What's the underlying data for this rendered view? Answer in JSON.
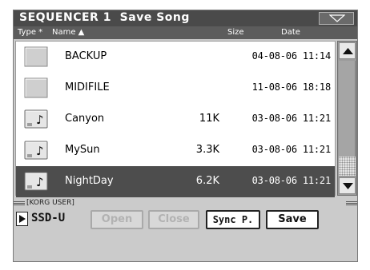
{
  "window": {
    "title": "SEQUENCER 1  Save Song",
    "menu_icon": "triangle-down-icon"
  },
  "columns": {
    "type": "Type *",
    "name": "Name ▲",
    "size": "Size",
    "date": "Date"
  },
  "files": [
    {
      "icon": "folder-icon",
      "name": "BACKUP",
      "size": "",
      "date": "04-08-06 11:14",
      "selected": false
    },
    {
      "icon": "folder-icon",
      "name": "MIDIFILE",
      "size": "",
      "date": "11-08-06 18:18",
      "selected": false
    },
    {
      "icon": "song-file-icon",
      "name": "Canyon",
      "size": "11K",
      "date": "03-08-06 11:21",
      "selected": false
    },
    {
      "icon": "song-file-icon",
      "name": "MySun",
      "size": "3.3K",
      "date": "03-08-06 11:21",
      "selected": false
    },
    {
      "icon": "song-file-icon",
      "name": "NightDay",
      "size": "6.2K",
      "date": "03-08-06 11:21",
      "selected": true
    }
  ],
  "path": "[KORG USER]",
  "device": "SSD-U",
  "buttons": {
    "open": "Open",
    "close": "Close",
    "sync": "Sync P.",
    "save": "Save"
  },
  "scrollbar": {
    "position": 0.0,
    "visible_fraction": 0.83
  },
  "colors": {
    "title_bg": "#4a4a4a",
    "selected_row": "#4d4d4d",
    "panel_bg": "#cbcbcb"
  }
}
